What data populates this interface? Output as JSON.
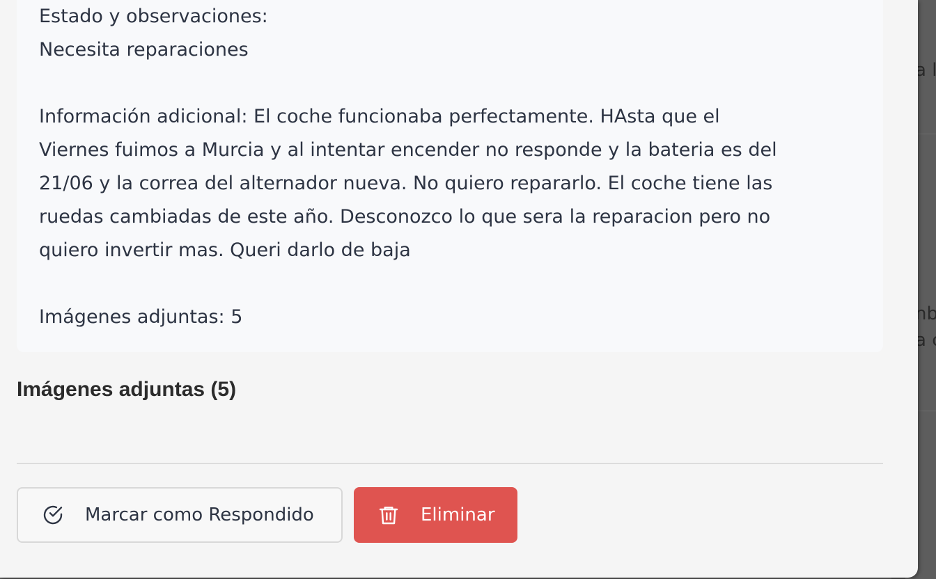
{
  "background": {
    "text_top": "a lo",
    "text_mid": "nb",
    "text_mid2": "a c"
  },
  "info": {
    "lines": [
      "Estado y observaciones:",
      "Necesita reparaciones",
      "",
      "Información adicional: El coche funcionaba perfectamente. HAsta que el",
      "Viernes fuimos a Murcia y al intentar encender no responde y la bateria es del",
      "21/06 y la correa del alternador nueva. No quiero repararlo. El coche tiene las",
      "ruedas cambiadas de este año. Desconozco lo que sera la reparacion pero no",
      "quiero invertir mas. Queri darlo de baja",
      "",
      "Imágenes adjuntas: 5"
    ]
  },
  "attachments": {
    "title": "Imágenes adjuntas (5)"
  },
  "actions": {
    "mark_responded_label": "Marcar como Respondido",
    "mark_responded_icon": "check-circle-icon",
    "delete_label": "Eliminar",
    "delete_icon": "trash-icon",
    "delete_color": "#df5450"
  }
}
